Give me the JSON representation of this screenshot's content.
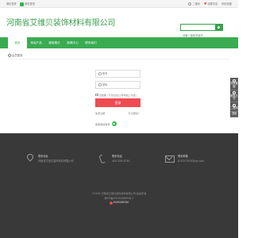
{
  "topbar": {
    "left_items": [
      "微信登录",
      "微信登录"
    ],
    "right_items": [
      "二维码",
      "收藏本站",
      "网站地图"
    ]
  },
  "header": {
    "site_title": "河南省艾维贝装饰材料有限公司",
    "search_placeholder": "请输入搜索关键词"
  },
  "nav": {
    "items": [
      "首页",
      "饰品产品",
      "服务展示",
      "新闻中心",
      "联系我们"
    ]
  },
  "breadcrumb": {
    "label": "会员登录"
  },
  "login": {
    "username_placeholder": "账号",
    "password_placeholder": "密码",
    "remember_label": "记住我",
    "remember_note": "(不建议在公用电脑上勾选)",
    "submit_label": "登录",
    "register_link": "免费注册",
    "forgot_link": "忘记密码？",
    "wechat_login_label": "使用微信登录"
  },
  "side_tools": [
    "在线客服",
    "联系方式",
    "二维码",
    "顶部"
  ],
  "footer": {
    "address_label": "联系地址",
    "address_value": "河南省艾维贝装饰材料有限公司",
    "phone_label": "联系电话",
    "phone_value": "400-928-6780",
    "email_label": "联系邮箱",
    "email_value": "815257635@qq.com",
    "copyright": "©2024 河南省艾维贝装饰材料有限公司 版权所有",
    "icp": "豫ICP备2023034695号-1",
    "hotline": "4009286780"
  },
  "colors": {
    "brand_green": "#3aab51",
    "login_button": "#ef4b52",
    "footer_bg": "#393939"
  }
}
